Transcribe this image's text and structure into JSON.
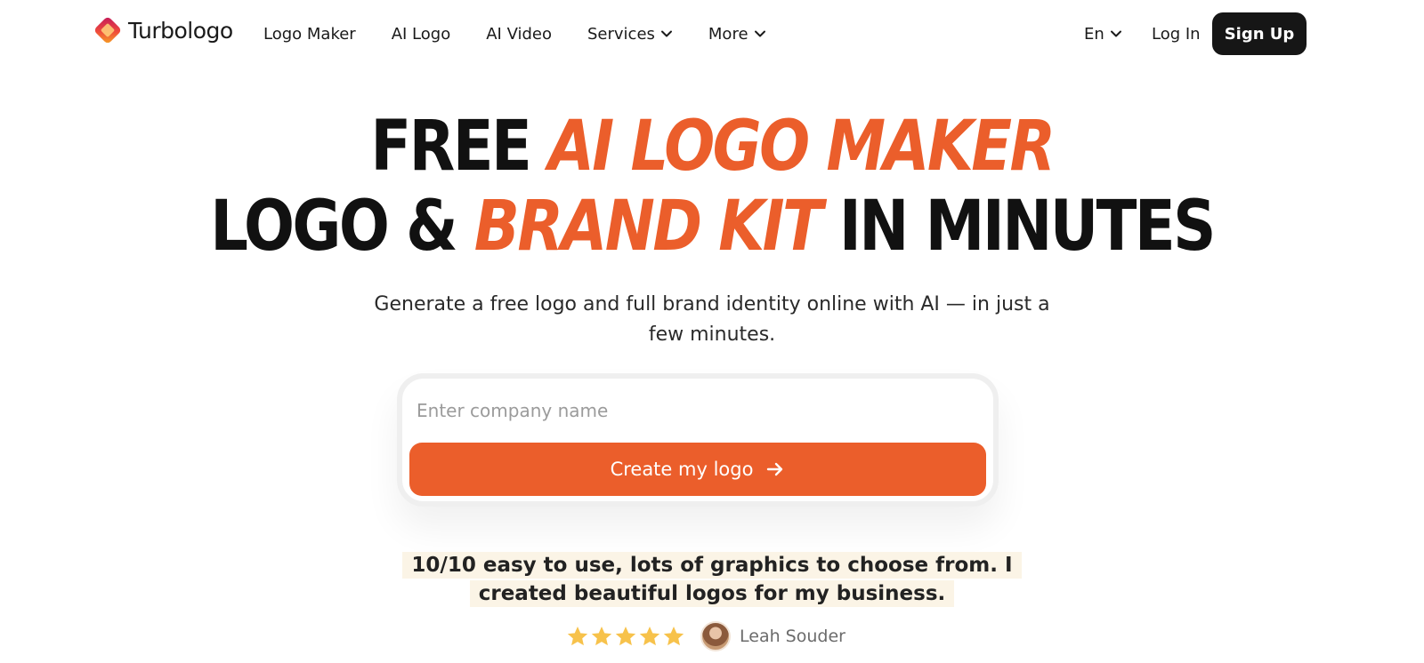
{
  "brand": {
    "name": "Turbologo",
    "accent_color": "#eb5e2b"
  },
  "nav": {
    "items": [
      {
        "label": "Logo Maker",
        "has_dropdown": false
      },
      {
        "label": "AI Logo",
        "has_dropdown": false
      },
      {
        "label": "AI Video",
        "has_dropdown": false
      },
      {
        "label": "Services",
        "has_dropdown": true
      },
      {
        "label": "More",
        "has_dropdown": true
      }
    ],
    "language": "En",
    "login": "Log In",
    "signup": "Sign Up"
  },
  "hero": {
    "line1_plain": "FREE ",
    "line1_accent": "AI LOGO MAKER",
    "line2_plain_start": "LOGO & ",
    "line2_accent": "BRAND KIT",
    "line2_plain_end": " IN MINUTES",
    "subtitle": "Generate a free logo and full brand identity online with AI — in just a few minutes."
  },
  "form": {
    "input_placeholder": "Enter company name",
    "input_value": "",
    "button_label": "Create my logo"
  },
  "testimonial": {
    "quote": "10/10 easy to use, lots of graphics to choose from. I created beautiful logos for my business.",
    "rating": 5,
    "reviewer": "Leah Souder",
    "star_color": "#f7c24b"
  }
}
